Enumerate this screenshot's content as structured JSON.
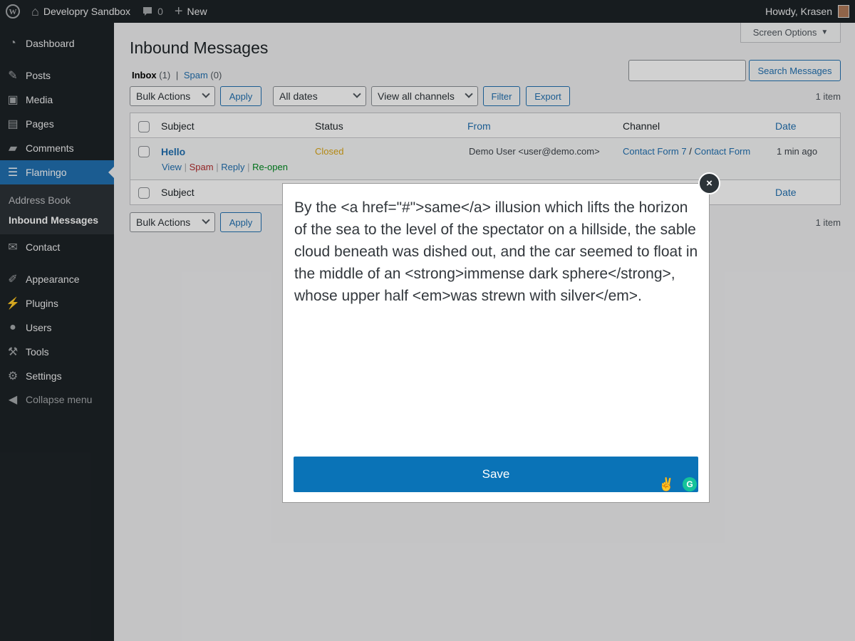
{
  "adminbar": {
    "site_name": "Developry Sandbox",
    "comments_count": "0",
    "new_label": "New",
    "greeting": "Howdy, Krasen"
  },
  "sidebar": {
    "items": [
      {
        "label": "Dashboard",
        "icon": "dashboard-icon"
      },
      {
        "label": "Posts",
        "icon": "pin-icon"
      },
      {
        "label": "Media",
        "icon": "media-icon"
      },
      {
        "label": "Pages",
        "icon": "pages-icon"
      },
      {
        "label": "Comments",
        "icon": "comment-icon"
      },
      {
        "label": "Flamingo",
        "icon": "list-icon"
      },
      {
        "label": "Contact",
        "icon": "mail-icon"
      },
      {
        "label": "Appearance",
        "icon": "brush-icon"
      },
      {
        "label": "Plugins",
        "icon": "plugin-icon"
      },
      {
        "label": "Users",
        "icon": "user-icon"
      },
      {
        "label": "Tools",
        "icon": "wrench-icon"
      },
      {
        "label": "Settings",
        "icon": "settings-icon"
      },
      {
        "label": "Collapse menu",
        "icon": "collapse-icon"
      }
    ],
    "submenu": [
      "Address Book",
      "Inbound Messages"
    ]
  },
  "page": {
    "screen_options": "Screen Options",
    "title": "Inbound Messages",
    "views": {
      "inbox": "Inbox",
      "inbox_count": "(1)",
      "separator": "|",
      "spam": "Spam",
      "spam_count": "(0)"
    },
    "search_button": "Search Messages",
    "search_value": "",
    "bulk_actions": "Bulk Actions",
    "apply": "Apply",
    "dates_filter": "All dates",
    "channels_filter": "View all channels",
    "filter": "Filter",
    "export": "Export",
    "item_count": "1 item"
  },
  "table": {
    "columns": [
      "Subject",
      "Status",
      "From",
      "Channel",
      "Date"
    ],
    "rows": [
      {
        "subject": "Hello",
        "status": "Closed",
        "from": "Demo User <user@demo.com>",
        "channel_a": "Contact Form 7",
        "channel_sep": "/",
        "channel_b": "Contact Form",
        "date": "1 min ago",
        "actions": {
          "view": "View",
          "spam": "Spam",
          "reply": "Reply",
          "reopen": "Re-open",
          "sep": "|"
        }
      }
    ]
  },
  "modal": {
    "text": "By the <a href=\"#\">same</a> illusion which lifts the horizon of the sea to the level of the spectator on a hillside, the sable cloud beneath was dished out, and the car seemed to float in the middle of an <strong>immense dark sphere</strong>, whose upper half <em>was strewn with silver</em>.",
    "save_label": "Save",
    "close_glyph": "×"
  }
}
